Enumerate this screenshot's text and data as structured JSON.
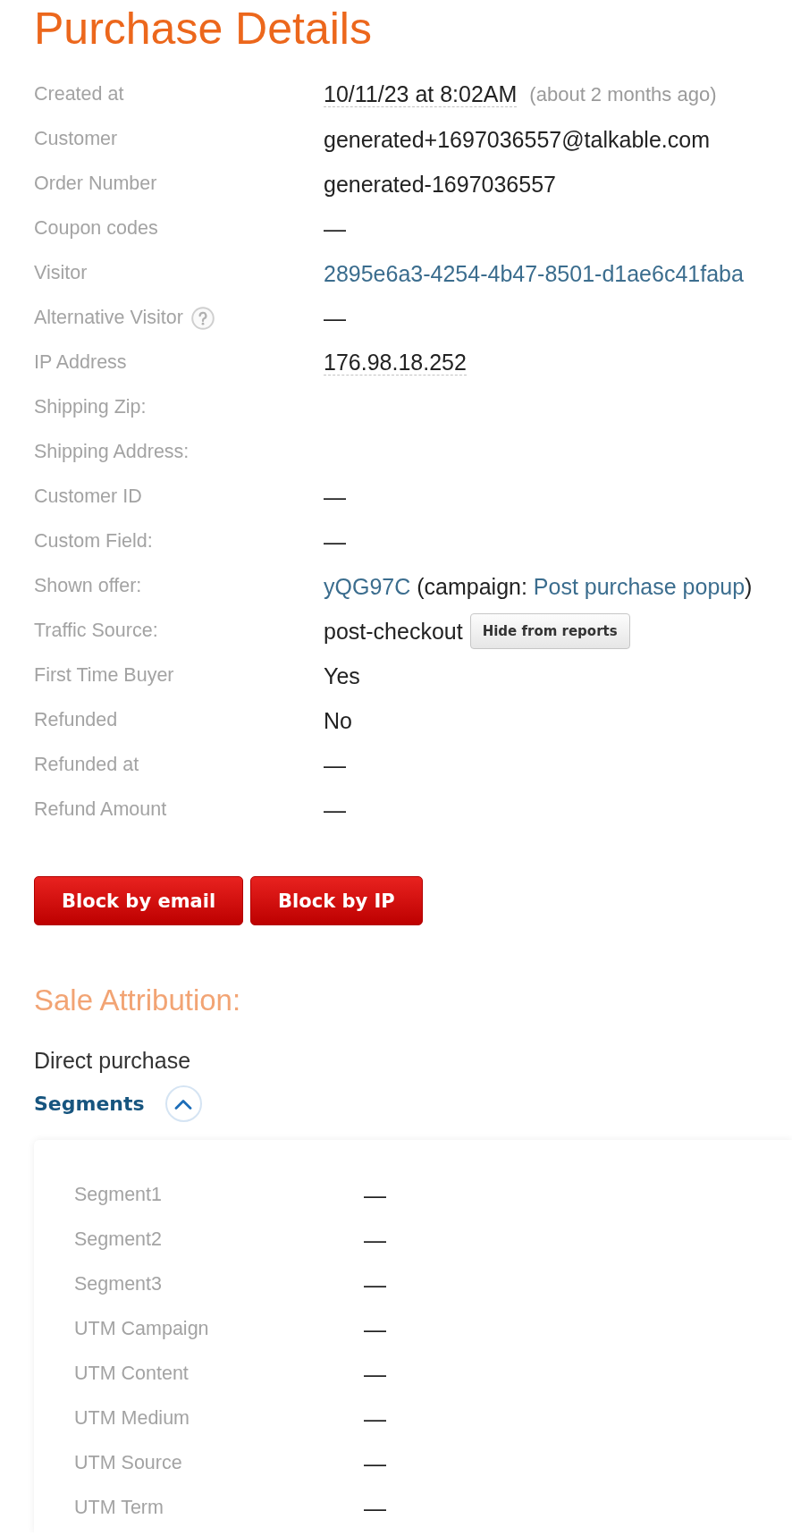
{
  "title": "Purchase Details",
  "details": [
    {
      "label": "Created at",
      "kind": "dotted",
      "value": "10/11/23 at 8:02AM",
      "note": "(about 2 months ago)"
    },
    {
      "label": "Customer",
      "kind": "text",
      "value": "generated+1697036557@talkable.com"
    },
    {
      "label": "Order Number",
      "kind": "text",
      "value": "generated-1697036557"
    },
    {
      "label": "Coupon codes",
      "kind": "text",
      "value": "—"
    },
    {
      "label": "Visitor",
      "kind": "link",
      "value": "2895e6a3-4254-4b47-8501-d1ae6c41faba"
    },
    {
      "label": "Alternative Visitor",
      "help": true,
      "kind": "text",
      "value": "—"
    },
    {
      "label": "IP Address",
      "kind": "dotted",
      "value": "176.98.18.252"
    },
    {
      "label": "Shipping Zip:",
      "kind": "empty"
    },
    {
      "label": "Shipping Address:",
      "kind": "empty"
    },
    {
      "label": "Customer ID",
      "kind": "text",
      "value": "—"
    },
    {
      "label": "Custom Field:",
      "kind": "text",
      "value": "—"
    },
    {
      "label": "Shown offer:",
      "kind": "sentence",
      "parts": [
        {
          "kind": "link",
          "text": "yQG97C"
        },
        {
          "kind": "text",
          "text": " (campaign: "
        },
        {
          "kind": "link",
          "text": "Post purchase popup"
        },
        {
          "kind": "text",
          "text": ")"
        }
      ]
    },
    {
      "label": "Traffic Source:",
      "kind": "source",
      "value": "post-checkout",
      "button": "Hide from reports"
    },
    {
      "label": "First Time Buyer",
      "kind": "text",
      "value": "Yes"
    },
    {
      "label": "Refunded",
      "kind": "text",
      "value": "No"
    },
    {
      "label": "Refunded at",
      "kind": "text",
      "value": "—"
    },
    {
      "label": "Refund Amount",
      "kind": "text",
      "value": "—"
    }
  ],
  "actions": [
    "Block by email",
    "Block by IP"
  ],
  "sale_attribution": {
    "title": "Sale Attribution:",
    "text": "Direct purchase",
    "segments": {
      "label": "Segments",
      "expanded": true,
      "rows": [
        {
          "label": "Segment1",
          "kind": "text",
          "value": "—"
        },
        {
          "label": "Segment2",
          "kind": "text",
          "value": "—"
        },
        {
          "label": "Segment3",
          "kind": "text",
          "value": "—"
        },
        {
          "label": "UTM Campaign",
          "kind": "text",
          "value": "—"
        },
        {
          "label": "UTM Content",
          "kind": "text",
          "value": "—"
        },
        {
          "label": "UTM Medium",
          "kind": "text",
          "value": "—"
        },
        {
          "label": "UTM Source",
          "kind": "text",
          "value": "—"
        },
        {
          "label": "UTM Term",
          "kind": "text",
          "value": "—"
        }
      ]
    }
  }
}
